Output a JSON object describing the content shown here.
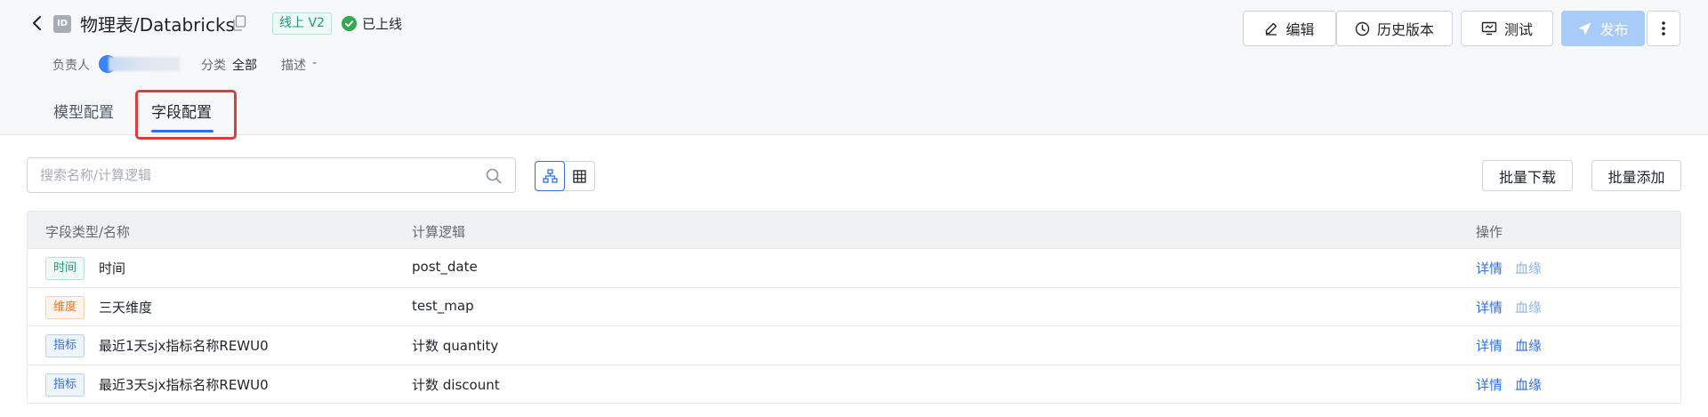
{
  "header": {
    "title": "物理表/Databricks",
    "id_icon_text": "ID",
    "version": "线上 V2",
    "status": "已上线",
    "owner_label": "负责人",
    "category_label": "分类",
    "category_value": "全部",
    "description_label": "描述",
    "description_value": "-",
    "buttons": {
      "edit": "编辑",
      "history": "历史版本",
      "test": "测试",
      "publish": "发布"
    }
  },
  "tabs": [
    {
      "label": "模型配置",
      "active": false
    },
    {
      "label": "字段配置",
      "active": true
    }
  ],
  "toolbar": {
    "search_placeholder": "搜索名称/计算逻辑",
    "batch_download": "批量下载",
    "batch_add": "批量添加"
  },
  "table": {
    "columns": [
      "字段类型/名称",
      "计算逻辑",
      "操作"
    ],
    "rows": [
      {
        "type": "时间",
        "name": "时间",
        "logic": "post_date",
        "action1": "详情",
        "action2": "血缘"
      },
      {
        "type": "维度",
        "name": "三天维度",
        "logic": "test_map",
        "action1": "详情",
        "action2": "血缘"
      },
      {
        "type": "指标",
        "name": "最近1天sjx指标名称REWU0",
        "logic": "计数 quantity",
        "action1": "详情",
        "action2": "血缘"
      },
      {
        "type": "指标",
        "name": "最近3天sjx指标名称REWU0",
        "logic": "计数 discount",
        "action1": "详情",
        "action2": "血缘"
      }
    ]
  },
  "colors": {
    "primary": "#2f6fe4",
    "link": "#2f6fe4",
    "link_muted": "#8db5ee",
    "online_green": "#34a853",
    "tag_time": "#1b9b79",
    "tag_dimension": "#e8762b",
    "tag_metric": "#2f6fe4",
    "highlight_red": "#e23b3b"
  },
  "icons": {
    "back": "chevron-left-icon",
    "copy": "copy-icon",
    "online": "check-circle-icon",
    "edit": "pencil-icon",
    "history": "clock-icon",
    "test": "monitor-icon",
    "publish": "send-icon",
    "more": "more-vertical-icon",
    "search": "search-icon",
    "tree_view": "hierarchy-icon",
    "grid_view": "grid-icon"
  }
}
